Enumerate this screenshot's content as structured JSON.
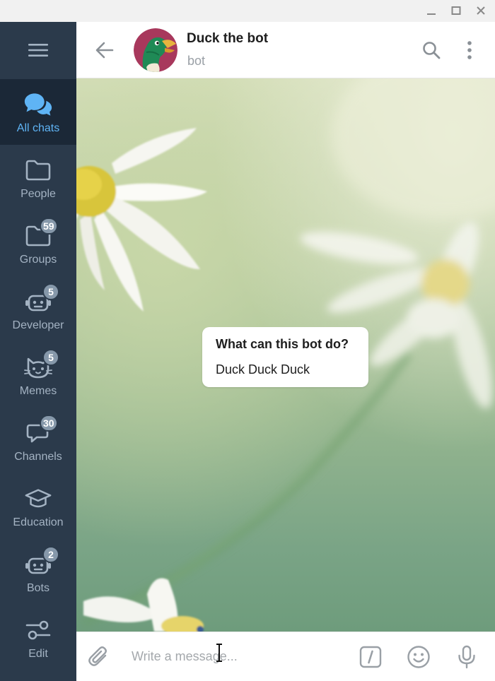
{
  "window": {
    "controls": [
      "minimize-icon",
      "maximize-icon",
      "close-icon"
    ]
  },
  "sidebar": {
    "menu_icon": "hamburger-icon",
    "folders": [
      {
        "label": "All chats",
        "icon": "chats-icon",
        "badge": "",
        "active": true
      },
      {
        "label": "People",
        "icon": "folder-icon",
        "badge": ""
      },
      {
        "label": "Groups",
        "icon": "folder-icon",
        "badge": "59"
      },
      {
        "label": "Developer",
        "icon": "robot-icon",
        "badge": "5"
      },
      {
        "label": "Memes",
        "icon": "cat-icon",
        "badge": "5"
      },
      {
        "label": "Channels",
        "icon": "megaphone-icon",
        "badge": "30"
      },
      {
        "label": "Education",
        "icon": "graduation-cap-icon",
        "badge": ""
      },
      {
        "label": "Bots",
        "icon": "robot-icon",
        "badge": "2"
      },
      {
        "label": "Edit",
        "icon": "sliders-icon",
        "badge": ""
      }
    ],
    "colors": {
      "background": "#2b3a4b",
      "active": "#1b2837",
      "accent": "#5fb4f5"
    }
  },
  "header": {
    "name": "Duck the bot",
    "status": "bot",
    "avatar_icon": "duck-avatar",
    "actions": [
      "search-icon",
      "more-vertical-icon"
    ]
  },
  "bot_info": {
    "title": "What can this bot do?",
    "description": "Duck Duck Duck"
  },
  "composer": {
    "placeholder": "Write a message...",
    "value": "",
    "icons": [
      "attach-icon",
      "bot-commands-icon",
      "emoji-icon",
      "microphone-icon"
    ]
  }
}
